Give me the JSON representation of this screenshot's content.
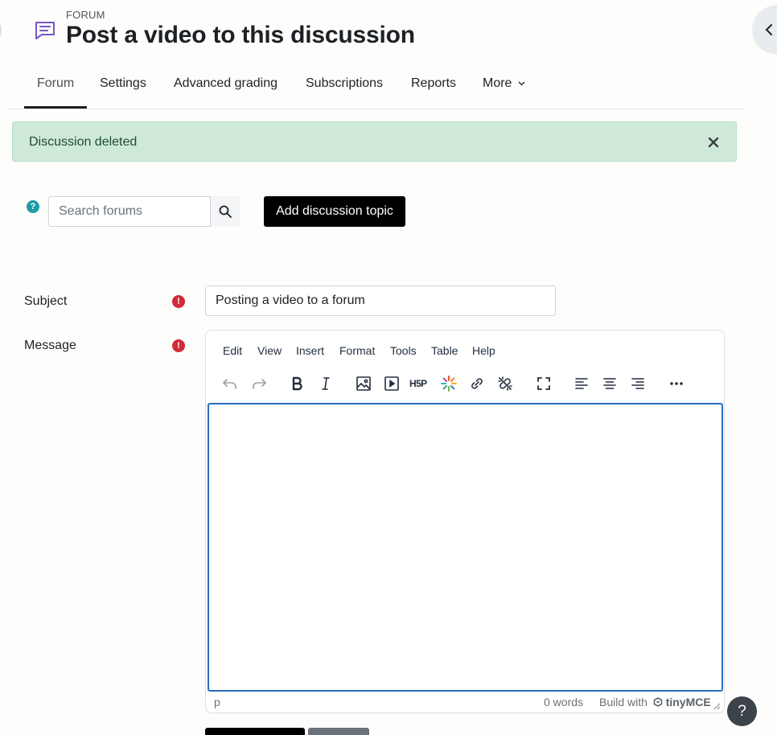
{
  "header": {
    "kicker": "FORUM",
    "title": "Post a video to this discussion",
    "icon": "forum-chat-icon",
    "icon_color": "#7a55c8"
  },
  "tabs": [
    {
      "label": "Forum",
      "active": true
    },
    {
      "label": "Settings"
    },
    {
      "label": "Advanced grading"
    },
    {
      "label": "Subscriptions"
    },
    {
      "label": "Reports"
    },
    {
      "label": "More"
    }
  ],
  "alert": {
    "text": "Discussion deleted",
    "close_icon": "close-icon",
    "bg_color": "#cfe9d8"
  },
  "search": {
    "placeholder": "Search forums",
    "help_glyph": "?",
    "button_icon": "search-icon"
  },
  "add_topic_label": "Add discussion topic",
  "form": {
    "subject_label": "Subject",
    "subject_value": "Posting a video to a forum",
    "message_label": "Message",
    "required_glyph": "!",
    "required_color": "#d22a3b"
  },
  "editor": {
    "menus": [
      "Edit",
      "View",
      "Insert",
      "Format",
      "Tools",
      "Table",
      "Help"
    ],
    "toolbar_icons": [
      "undo-icon",
      "redo-icon",
      "bold-icon",
      "italic-icon",
      "image-icon",
      "media-icon",
      "h5p-icon",
      "kaltura-icon",
      "link-icon",
      "unlink-icon",
      "fullscreen-icon",
      "align-left-icon",
      "align-center-icon",
      "align-right-icon",
      "more-icon"
    ],
    "h5p_label": "H5P",
    "status_path": "p",
    "word_count": "0 words",
    "build_with": "Build with",
    "brand": "tinyMCE"
  },
  "help_fab_glyph": "?"
}
